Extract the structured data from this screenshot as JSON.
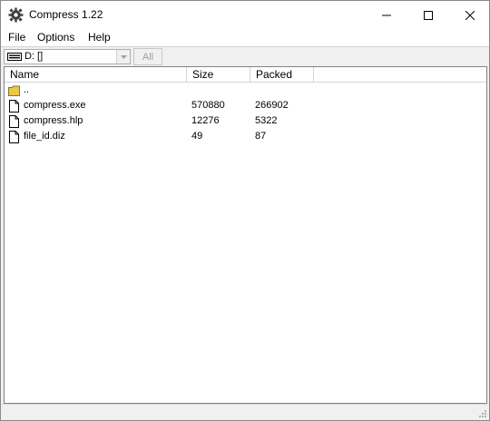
{
  "window": {
    "title": "Compress 1.22"
  },
  "menu": {
    "items": [
      "File",
      "Options",
      "Help"
    ]
  },
  "toolbar": {
    "drive": "D: []",
    "all_label": "All"
  },
  "list": {
    "columns": [
      "Name",
      "Size",
      "Packed"
    ],
    "rows": [
      {
        "icon": "folder-icon",
        "name": "..",
        "size": "",
        "packed": ""
      },
      {
        "icon": "file-icon",
        "name": "compress.exe",
        "size": "570880",
        "packed": "266902"
      },
      {
        "icon": "file-icon",
        "name": "compress.hlp",
        "size": "12276",
        "packed": "5322"
      },
      {
        "icon": "file-icon",
        "name": "file_id.diz",
        "size": "49",
        "packed": "87"
      }
    ]
  },
  "colors": {
    "folder": "#e8c84a",
    "border": "#828282"
  }
}
